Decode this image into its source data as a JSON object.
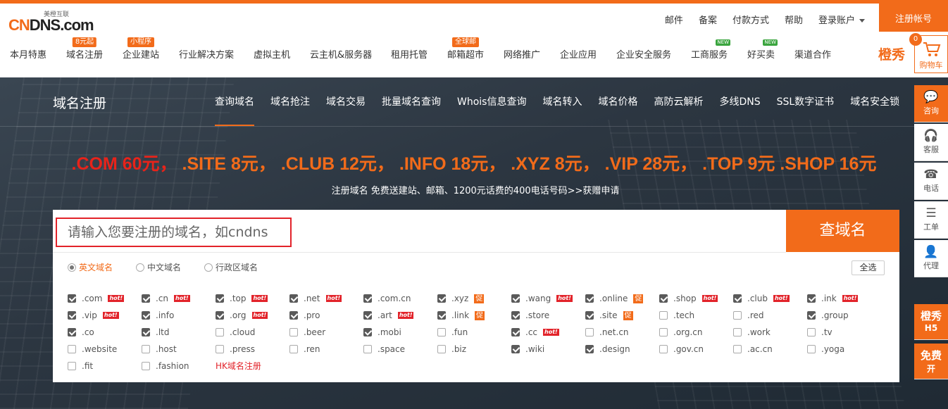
{
  "header": {
    "logo_small": "美橙互联",
    "logo_text": "CN",
    "logo_text2": "DNS.com",
    "links": [
      "邮件",
      "备案",
      "付款方式",
      "帮助"
    ],
    "login": "登录账户",
    "register": "注册帐号"
  },
  "nav": {
    "items": [
      {
        "label": "本月特惠",
        "badge": ""
      },
      {
        "label": "域名注册",
        "badge": "8元起"
      },
      {
        "label": "企业建站",
        "badge": "小程序"
      },
      {
        "label": "行业解决方案",
        "badge": ""
      },
      {
        "label": "虚拟主机",
        "badge": ""
      },
      {
        "label": "云主机&服务器",
        "badge": ""
      },
      {
        "label": "租用托管",
        "badge": ""
      },
      {
        "label": "邮箱超市",
        "badge": "全球邮"
      },
      {
        "label": "网络推广",
        "badge": ""
      },
      {
        "label": "企业应用",
        "badge": ""
      },
      {
        "label": "企业安全服务",
        "badge": ""
      },
      {
        "label": "工商服务",
        "badge": "NEW"
      },
      {
        "label": "好买卖",
        "badge": "NEW"
      },
      {
        "label": "渠道合作",
        "badge": ""
      }
    ],
    "brand": "橙秀",
    "cart_count": "0",
    "cart_label": "购物车"
  },
  "subnav": {
    "title": "域名注册",
    "tabs": [
      "查询域名",
      "域名抢注",
      "域名交易",
      "批量域名查询",
      "Whois信息查询",
      "域名转入",
      "域名价格",
      "高防云解析",
      "多线DNS",
      "SSL数字证书",
      "域名安全锁"
    ]
  },
  "promo": {
    "first": ".COM 60元，",
    "rest": " .SITE 8元， .CLUB 12元， .INFO 18元， .XYZ 8元， .VIP 28元， .TOP 9元 .SHOP 16元",
    "sub": "注册域名 免费送建站、邮箱、1200元话费的400电话号码>>获赠申请"
  },
  "search": {
    "placeholder": "请输入您要注册的域名，如cndns",
    "button": "查域名",
    "radios": [
      "英文域名",
      "中文域名",
      "行政区域名"
    ],
    "select_all": "全选",
    "hot_label": "hot!",
    "promo_label": "促",
    "hk_link": "HK域名注册",
    "tlds": [
      [
        {
          "n": ".com",
          "c": true,
          "t": "hot"
        },
        {
          "n": ".cn",
          "c": true,
          "t": "hot"
        },
        {
          "n": ".top",
          "c": true,
          "t": "hot"
        },
        {
          "n": ".net",
          "c": true,
          "t": "hot"
        },
        {
          "n": ".com.cn",
          "c": true,
          "t": ""
        },
        {
          "n": ".xyz",
          "c": true,
          "t": "promo"
        },
        {
          "n": ".wang",
          "c": true,
          "t": "hot"
        },
        {
          "n": ".online",
          "c": true,
          "t": "promo"
        },
        {
          "n": ".shop",
          "c": true,
          "t": "hot"
        },
        {
          "n": ".club",
          "c": true,
          "t": "hot"
        },
        {
          "n": ".ink",
          "c": true,
          "t": "hot"
        }
      ],
      [
        {
          "n": ".vip",
          "c": true,
          "t": "hot"
        },
        {
          "n": ".info",
          "c": true,
          "t": ""
        },
        {
          "n": ".org",
          "c": true,
          "t": "hot"
        },
        {
          "n": ".pro",
          "c": true,
          "t": ""
        },
        {
          "n": ".art",
          "c": true,
          "t": "hot"
        },
        {
          "n": ".link",
          "c": true,
          "t": "promo"
        },
        {
          "n": ".store",
          "c": true,
          "t": ""
        },
        {
          "n": ".site",
          "c": true,
          "t": "promo"
        },
        {
          "n": ".tech",
          "c": false,
          "t": ""
        },
        {
          "n": ".red",
          "c": false,
          "t": ""
        },
        {
          "n": ".group",
          "c": true,
          "t": ""
        }
      ],
      [
        {
          "n": ".co",
          "c": true,
          "t": ""
        },
        {
          "n": ".ltd",
          "c": true,
          "t": ""
        },
        {
          "n": ".cloud",
          "c": false,
          "t": ""
        },
        {
          "n": ".beer",
          "c": false,
          "t": ""
        },
        {
          "n": ".mobi",
          "c": true,
          "t": ""
        },
        {
          "n": ".fun",
          "c": false,
          "t": ""
        },
        {
          "n": ".cc",
          "c": true,
          "t": "hot"
        },
        {
          "n": ".net.cn",
          "c": false,
          "t": ""
        },
        {
          "n": ".org.cn",
          "c": false,
          "t": ""
        },
        {
          "n": ".work",
          "c": false,
          "t": ""
        },
        {
          "n": ".tv",
          "c": false,
          "t": ""
        }
      ],
      [
        {
          "n": ".website",
          "c": false,
          "t": ""
        },
        {
          "n": ".host",
          "c": false,
          "t": ""
        },
        {
          "n": ".press",
          "c": false,
          "t": ""
        },
        {
          "n": ".ren",
          "c": false,
          "t": ""
        },
        {
          "n": ".space",
          "c": false,
          "t": ""
        },
        {
          "n": ".biz",
          "c": false,
          "t": ""
        },
        {
          "n": ".wiki",
          "c": true,
          "t": ""
        },
        {
          "n": ".design",
          "c": true,
          "t": ""
        },
        {
          "n": ".gov.cn",
          "c": false,
          "t": ""
        },
        {
          "n": ".ac.cn",
          "c": false,
          "t": ""
        },
        {
          "n": ".yoga",
          "c": false,
          "t": ""
        }
      ],
      [
        {
          "n": ".fit",
          "c": false,
          "t": ""
        },
        {
          "n": ".fashion",
          "c": false,
          "t": ""
        }
      ]
    ]
  },
  "sidebar": [
    {
      "label": "咨询",
      "icon": "chat-icon",
      "orange": true
    },
    {
      "label": "客服",
      "icon": "headset-icon",
      "orange": false
    },
    {
      "label": "电话",
      "icon": "phone-icon",
      "orange": false
    },
    {
      "label": "工单",
      "icon": "ticket-icon",
      "orange": false
    },
    {
      "label": "代理",
      "icon": "user-icon",
      "orange": false
    }
  ],
  "sidebar_bottom": [
    {
      "label": "橙秀",
      "sub": "H5"
    },
    {
      "label": "免费",
      "sub": "开"
    }
  ],
  "colors": {
    "accent": "#f26b1a",
    "alert": "#e2232a"
  }
}
